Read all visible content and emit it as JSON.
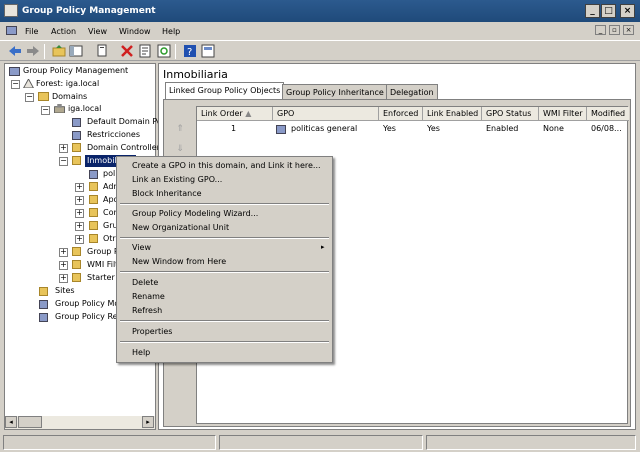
{
  "window": {
    "title": "Group Policy Management"
  },
  "menu": [
    "File",
    "Action",
    "View",
    "Window",
    "Help"
  ],
  "toolbar": [
    "back-icon",
    "forward-icon",
    "up-folder-icon",
    "show-hide-tree-icon",
    "copy-icon",
    "delete-icon",
    "properties-icon",
    "refresh-icon",
    "help-icon",
    "details-icon"
  ],
  "tree": {
    "root": "Group Policy Management",
    "forest": "Forest: iga.local",
    "domains": "Domains",
    "domain": "iga.local",
    "default_policy": "Default Domain Po",
    "restricciones": "Restricciones",
    "domain_controllers": "Domain Controller",
    "selected_ou": "Inmobiliaria",
    "child_gpo": "politi",
    "children": [
      "Adm",
      "Apo",
      "Com",
      "Gru",
      "Otr"
    ],
    "group_policy_objects": "Group P",
    "wmi_filters": "WMI Filt",
    "starter": "Starter",
    "sites": "Sites",
    "modeling": "Group Policy Mo",
    "results": "Group Policy Re"
  },
  "right": {
    "title": "Inmobiliaria",
    "tabs": [
      "Linked Group Policy Objects",
      "Group Policy Inheritance",
      "Delegation"
    ],
    "columns": [
      "Link Order",
      "GPO",
      "Enforced",
      "Link Enabled",
      "GPO Status",
      "WMI Filter",
      "Modified"
    ],
    "sort_indicator": "▲",
    "rows": [
      [
        "1",
        "politicas general",
        "Yes",
        "Yes",
        "Enabled",
        "None",
        "06/08..."
      ]
    ]
  },
  "context_menu": [
    [
      "Create a GPO in this domain, and Link it here...",
      "Link an Existing GPO...",
      "Block Inheritance"
    ],
    [
      "Group Policy Modeling Wizard...",
      "New Organizational Unit"
    ],
    [
      "View",
      "New Window from Here"
    ],
    [
      "Delete",
      "Rename",
      "Refresh"
    ],
    [
      "Properties"
    ],
    [
      "Help"
    ]
  ],
  "colors": {
    "titlebar": "#2c5a8e",
    "selection": "#0a246a",
    "folder": "#e8c45a"
  }
}
